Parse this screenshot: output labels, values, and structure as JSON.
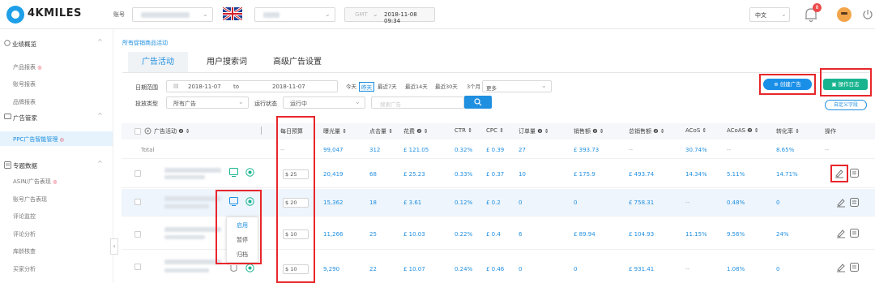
{
  "brand": {
    "name": "4KMILES",
    "accent": "#1f8fe0",
    "alert": "#e8262b",
    "success": "#19b48f"
  },
  "topbar": {
    "account_label": "账号",
    "timezone": "GMT",
    "datetime": "2018-11-08 09:34",
    "language": "中文",
    "notification_count": "8",
    "icons": [
      "uk-flag-icon",
      "bell-icon",
      "avatar",
      "power-icon"
    ]
  },
  "sidebar": {
    "sections": [
      {
        "title": "业绩概览",
        "items": [
          "产品报表",
          "账号报表",
          "品牌报表"
        ]
      },
      {
        "title": "广告管家",
        "items": [
          "PPC广告智能管理"
        ]
      },
      {
        "title": "专题数据",
        "items": [
          "ASIN/广告表现",
          "账号广告表现",
          "评论监控",
          "评论分析",
          "库龄核查",
          "买家分析"
        ]
      }
    ],
    "active_item": "PPC广告智能管理"
  },
  "main": {
    "breadcrumb": "所有促销商品活动",
    "tabs": [
      "广告活动",
      "用户搜索词",
      "高级广告设置"
    ],
    "filters": {
      "date_range_label": "日期范围",
      "date_from": "2018-11-07",
      "date_to_label": "to",
      "date_to": "2018-11-07",
      "quick_ranges": [
        "今天",
        "昨天",
        "最近7天",
        "最近14天",
        "最近30天",
        "3个月",
        "更多"
      ],
      "active_range": "昨天",
      "ad_type_label": "投放类型",
      "ad_type_value": "所有广告",
      "status_label": "运行状态",
      "status_value": "运行中",
      "search_placeholder": "搜索广告"
    },
    "buttons": {
      "create": "创建广告",
      "log": "操作日志",
      "custom_fields": "自定义字段"
    }
  },
  "table": {
    "headers": [
      "广告活动",
      "每日预算",
      "曝光量",
      "点击量",
      "花费",
      "CTR",
      "CPC",
      "订单量",
      "销售额",
      "总销售额",
      "ACoS",
      "ACoAS",
      "转化率",
      "操作"
    ],
    "total": {
      "label": "Total",
      "budget": "--",
      "impressions": "99,047",
      "clicks": "312",
      "spend": "£ 121.05",
      "ctr": "0.32%",
      "cpc": "£ 0.39",
      "orders": "27",
      "sales": "£ 393.73",
      "total_sales": "--",
      "acos": "30.74%",
      "acoas": "--",
      "conversion": "8.65%",
      "op": "--"
    },
    "rows": [
      {
        "budget": "$ 25",
        "impressions": "20,419",
        "clicks": "68",
        "spend": "£ 25.23",
        "ctr": "0.33%",
        "cpc": "£ 0.37",
        "orders": "10",
        "sales": "£ 175.9",
        "total_sales": "£ 493.74",
        "acos": "14.34%",
        "acoas": "5.11%",
        "conversion": "14.71%"
      },
      {
        "budget": "$ 20",
        "impressions": "15,362",
        "clicks": "18",
        "spend": "£ 3.61",
        "ctr": "0.12%",
        "cpc": "£ 0.2",
        "orders": "0",
        "sales": "0",
        "total_sales": "£ 758.31",
        "acos": "--",
        "acoas": "0.48%",
        "conversion": "0"
      },
      {
        "budget": "$ 10",
        "impressions": "11,266",
        "clicks": "25",
        "spend": "£ 10.03",
        "ctr": "0.22%",
        "cpc": "£ 0.4",
        "orders": "6",
        "sales": "£ 89.94",
        "total_sales": "£ 104.93",
        "acos": "11.15%",
        "acoas": "9.56%",
        "conversion": "24%"
      },
      {
        "budget": "$ 10",
        "impressions": "9,290",
        "clicks": "22",
        "spend": "£ 10.07",
        "ctr": "0.24%",
        "cpc": "£ 0.46",
        "orders": "0",
        "sales": "0",
        "total_sales": "£ 931.41",
        "acos": "--",
        "acoas": "1.08%",
        "conversion": "0"
      }
    ],
    "status_menu": [
      "启用",
      "暂停",
      "归档"
    ]
  }
}
